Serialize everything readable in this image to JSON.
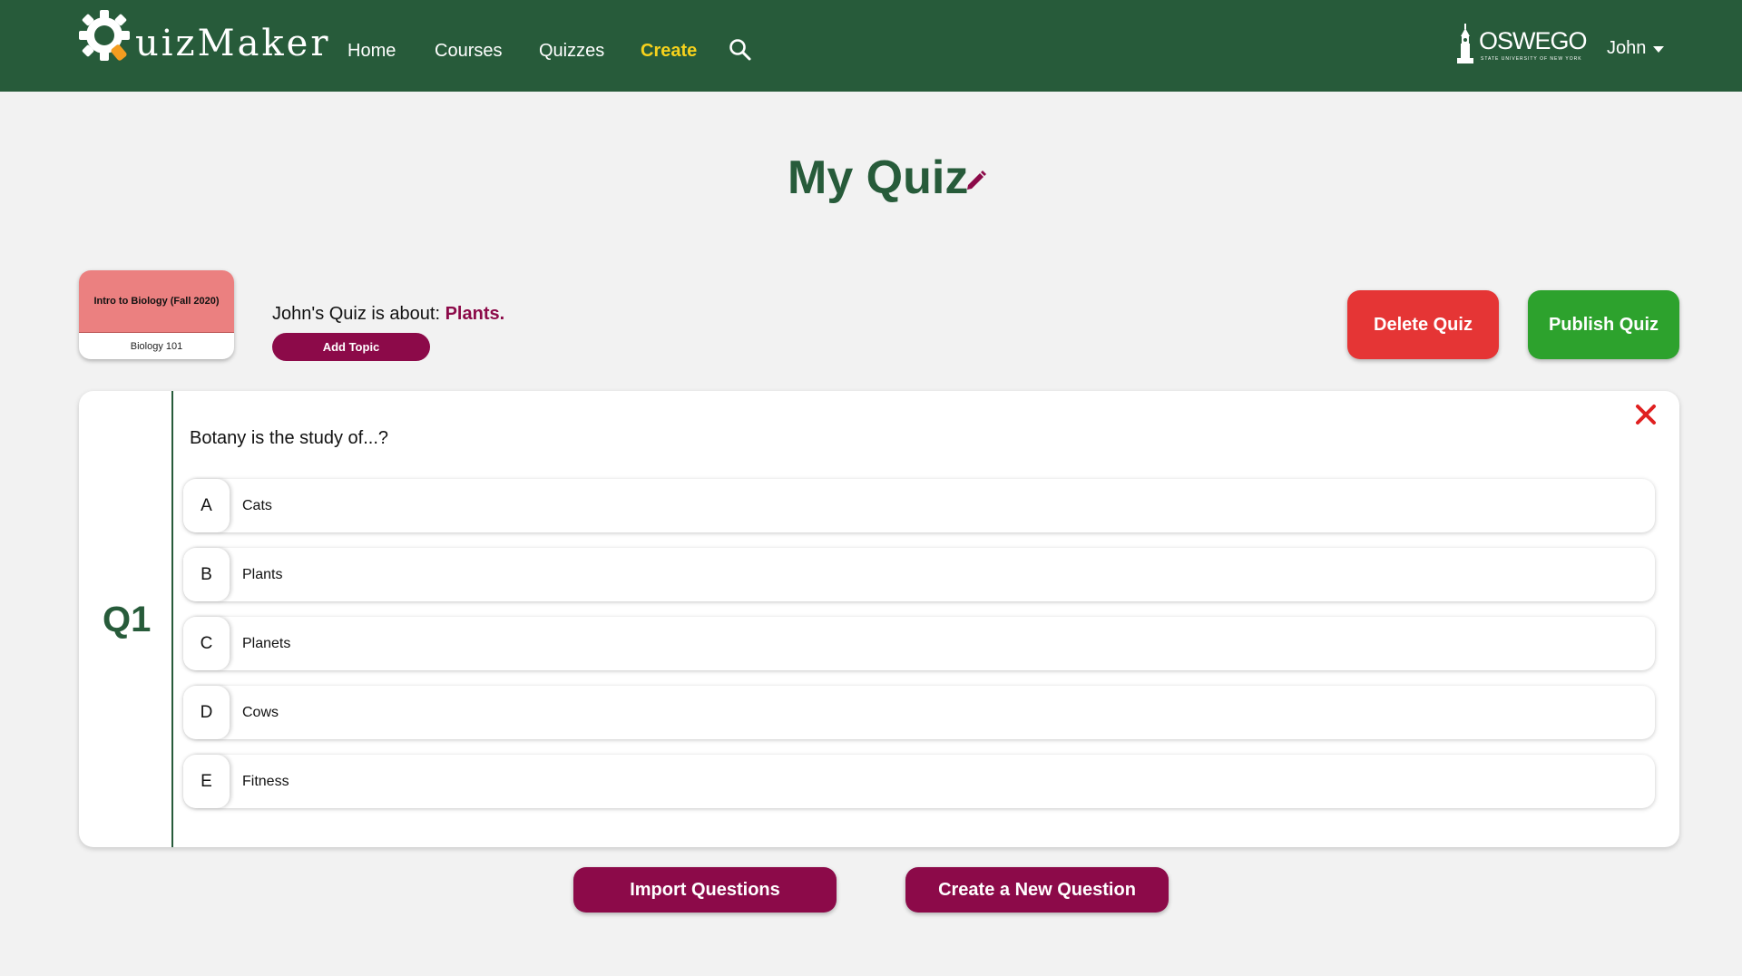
{
  "header": {
    "logo_text": "uizMaker",
    "nav": [
      {
        "label": "Home"
      },
      {
        "label": "Courses"
      },
      {
        "label": "Quizzes"
      },
      {
        "label": "Create"
      }
    ],
    "active_nav": "Create",
    "search_icon": "search-icon",
    "university_logo": "OSWEGO",
    "university_subtitle": "STATE UNIVERSITY OF NEW YORK",
    "user_name": "John"
  },
  "title": "My Quiz",
  "course": {
    "name": "Intro to Biology (Fall 2020)",
    "code": "Biology 101"
  },
  "topic": {
    "prefix": "John's Quiz is about:",
    "name": "Plants",
    "suffix": ".",
    "add_label": "Add Topic"
  },
  "actions": {
    "delete_label": "Delete Quiz",
    "publish_label": "Publish Quiz"
  },
  "question": {
    "number": "Q1",
    "text": "Botany is the study of...?",
    "options": [
      {
        "letter": "A",
        "text": "Cats"
      },
      {
        "letter": "B",
        "text": "Plants"
      },
      {
        "letter": "C",
        "text": "Planets"
      },
      {
        "letter": "D",
        "text": "Cows"
      },
      {
        "letter": "E",
        "text": "Fitness"
      }
    ]
  },
  "bottom": {
    "import_label": "Import Questions",
    "create_label": "Create a New Question"
  },
  "colors": {
    "header_green": "#275b3a",
    "active_yellow": "#f7d21c",
    "maroon": "#8c0a49",
    "delete_red": "#e53535",
    "publish_green": "#2da22d",
    "card_pink": "#eb8080"
  }
}
